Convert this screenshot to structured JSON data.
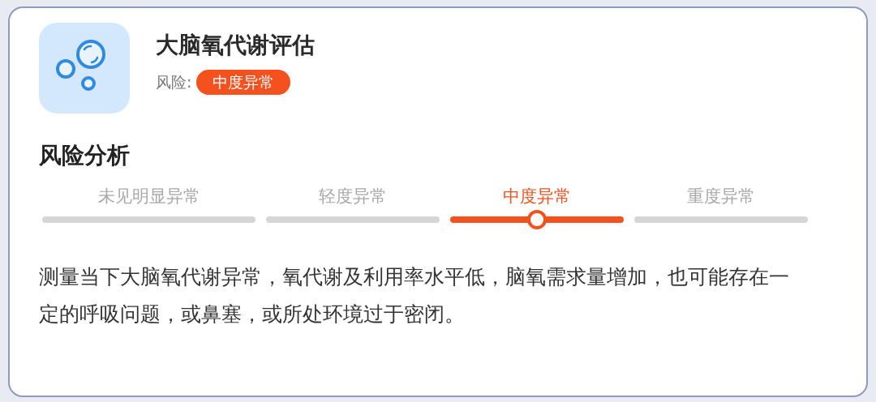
{
  "header": {
    "title": "大脑氧代谢评估",
    "risk_label": "风险:",
    "risk_badge": "中度异常"
  },
  "analysis": {
    "title": "风险分析",
    "levels": [
      {
        "label": "未见明显异常",
        "selected": false
      },
      {
        "label": "轻度异常",
        "selected": false
      },
      {
        "label": "中度异常",
        "selected": true
      },
      {
        "label": "重度异常",
        "selected": false
      }
    ],
    "description": "测量当下大脑氧代谢异常，氧代谢及利用率水平低，脑氧需求量增加，也可能存在一定的呼吸问题，或鼻塞，或所处环境过于密闭。"
  }
}
